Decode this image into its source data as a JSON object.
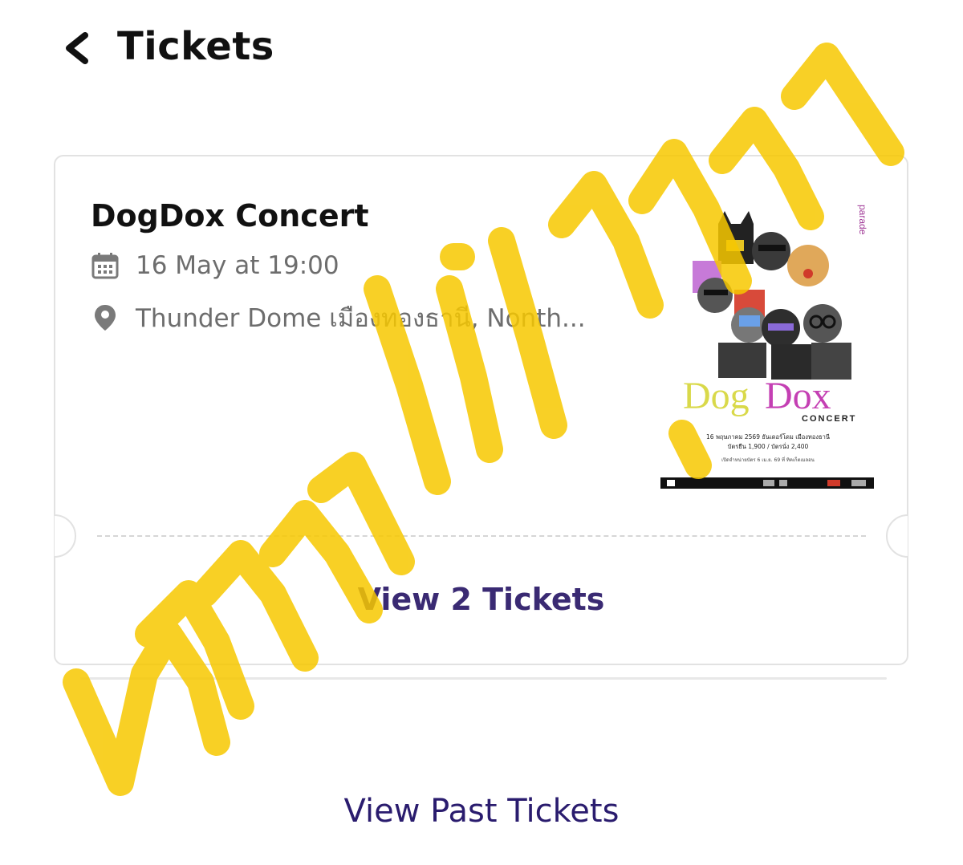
{
  "header": {
    "title": "Tickets",
    "back_icon": "chevron-left-icon"
  },
  "ticket": {
    "event_name": "DogDox Concert",
    "date_text": "16 May at 19:00",
    "venue_text": "Thunder Dome เมืองทองธานี, Nonth...",
    "date_icon": "calendar-icon",
    "venue_icon": "location-pin-icon",
    "view_tickets_label": "View 2 Tickets",
    "poster": {
      "title_part1": "Dog",
      "title_part2": "Dox",
      "subtitle": "CONCERT",
      "brand": "parade",
      "info_line1": "16 พฤษภาคม 2569 ธันเดอร์โดม เมืองทองธานี",
      "info_line2": "บัตรยืน 1,900 / บัตรนั่ง 2,400",
      "info_line3": "เปิดจำหน่ายบัตร 6 เม.ย. 69 ที่ ทิคเก็ตเมลอน",
      "colors": {
        "dog": "#d9d94a",
        "dox": "#c43fb3",
        "brand": "#a13c98"
      }
    }
  },
  "footer": {
    "view_past_label": "View Past Tickets"
  },
  "colors": {
    "accent": "#3a2a73",
    "overlay_scribble": "#f7c800",
    "muted_text": "#6d6d6d"
  }
}
